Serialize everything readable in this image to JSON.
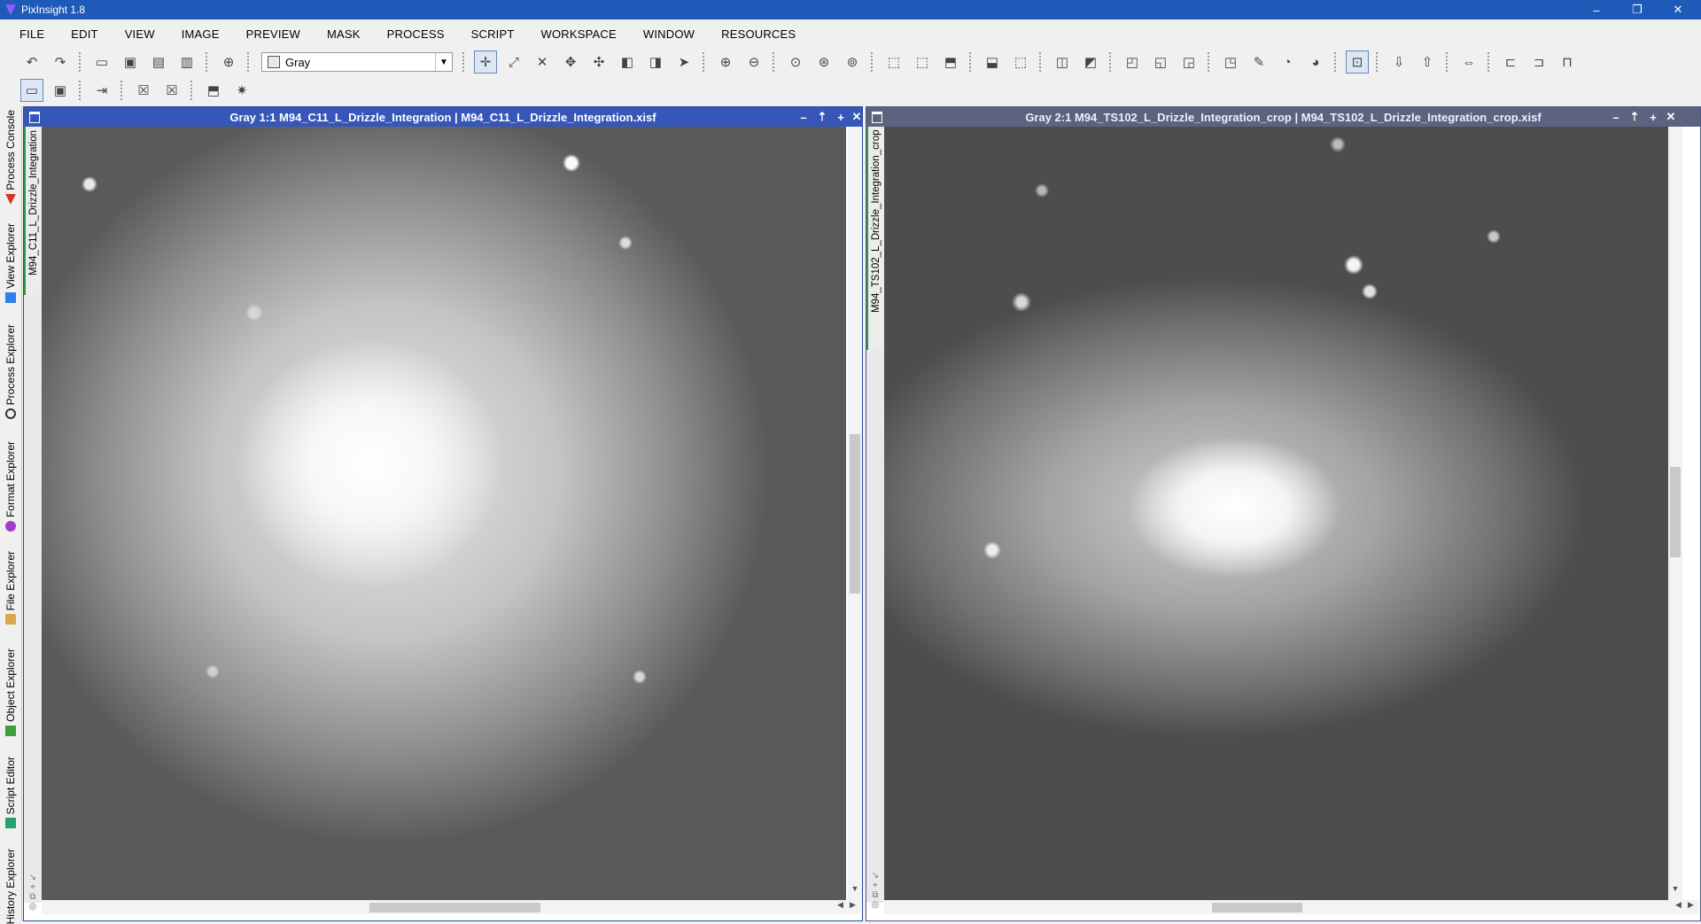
{
  "app": {
    "title": "PixInsight 1.8",
    "window_controls": [
      "–",
      "❐",
      "✕"
    ]
  },
  "menu": [
    "FILE",
    "EDIT",
    "VIEW",
    "IMAGE",
    "PREVIEW",
    "MASK",
    "PROCESS",
    "SCRIPT",
    "WORKSPACE",
    "WINDOW",
    "RESOURCES"
  ],
  "toolbar": {
    "color_space_select": "Gray"
  },
  "side_panel": {
    "tabs": [
      "Process Console",
      "View Explorer",
      "Process Explorer",
      "Format Explorer",
      "File Explorer",
      "Object Explorer",
      "Script Editor",
      "History Explorer"
    ],
    "tab_icon_colors": [
      "#d93025",
      "#2f80ed",
      "#333333",
      "#a53cc8",
      "#d6a84a",
      "#3aa040",
      "#2aa070",
      "#555555"
    ]
  },
  "image_windows": [
    {
      "title": "Gray 1:1 M94_C11_L_Drizzle_Integration | M94_C11_L_Drizzle_Integration.xisf",
      "view_id": "M94_C11_L_Drizzle_Integration"
    },
    {
      "title": "Gray 2:1 M94_TS102_L_Drizzle_Integration_crop | M94_TS102_L_Drizzle_Integration_crop.xisf",
      "view_id": "M94_TS102_L_Drizzle_Integration_crop"
    }
  ]
}
